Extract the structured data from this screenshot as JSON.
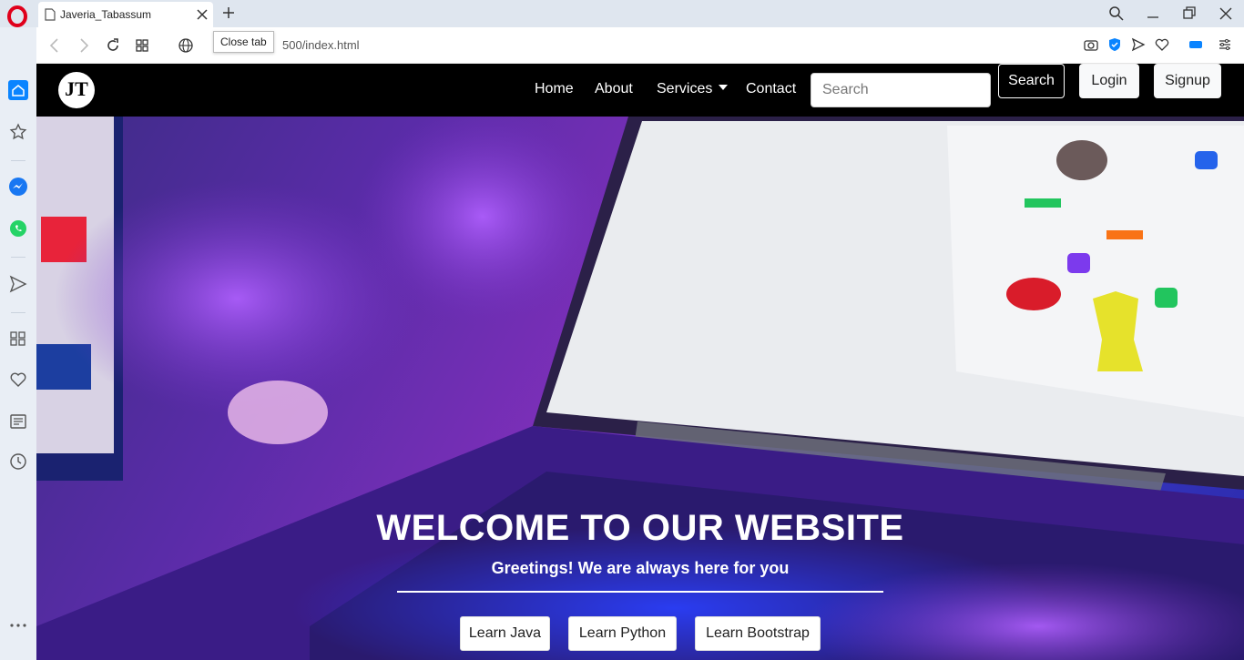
{
  "browser": {
    "tab_title": "Javeria_Tabassum",
    "url": "500/index.html",
    "tooltip": "Close tab"
  },
  "site": {
    "brand": "JT",
    "nav": {
      "home": "Home",
      "about": "About",
      "services": "Services",
      "contact": "Contact"
    },
    "search_placeholder": "Search",
    "search_button": "Search",
    "login": "Login",
    "signup": "Signup"
  },
  "hero": {
    "title": "WELCOME TO OUR WEBSITE",
    "subtitle": "Greetings! We are always here for you",
    "buttons": {
      "java": "Learn Java",
      "python": "Learn Python",
      "bootstrap": "Learn Bootstrap"
    }
  },
  "colors": {
    "accent": "#0a84ff",
    "opera_red": "#e0001b",
    "navbar": "#000000"
  }
}
